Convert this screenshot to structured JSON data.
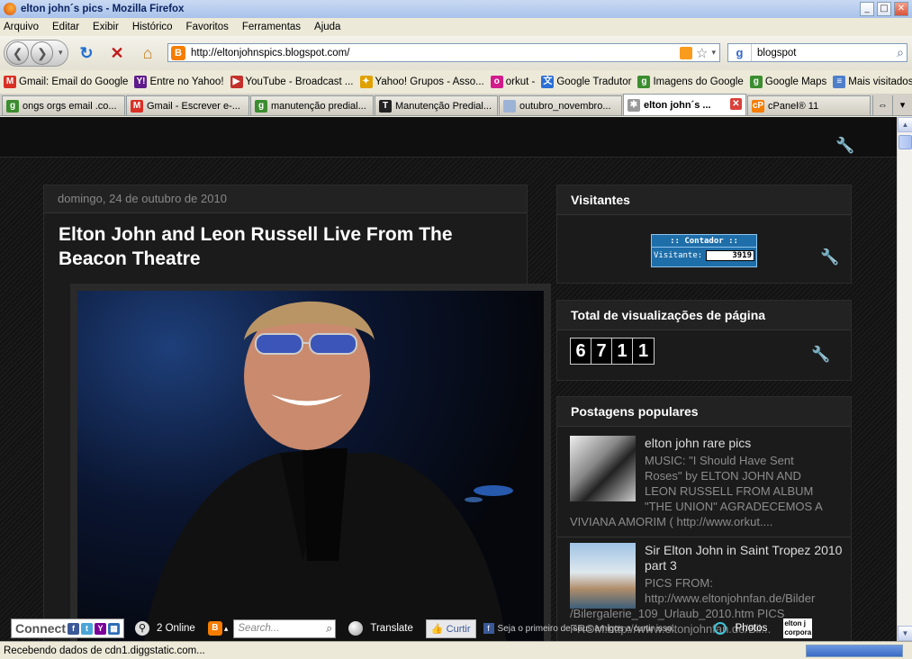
{
  "window": {
    "title": "elton john´s pics - Mozilla Firefox",
    "controls": [
      "_",
      "□",
      "✕"
    ]
  },
  "menu": [
    "Arquivo",
    "Editar",
    "Exibir",
    "Histórico",
    "Favoritos",
    "Ferramentas",
    "Ajuda"
  ],
  "nav": {
    "url": "http://eltonjohnspics.blogspot.com/",
    "search_value": "blogspot",
    "search_engine_icon": "google-icon"
  },
  "bookmarks": [
    {
      "label": "Gmail: Email do Google",
      "icon": "gmail-icon",
      "color": "#d93025",
      "glyph": "M"
    },
    {
      "label": "Entre no Yahoo!",
      "icon": "yahoo-icon",
      "color": "#5f1b8c",
      "glyph": "Y!"
    },
    {
      "label": "YouTube - Broadcast ...",
      "icon": "youtube-icon",
      "color": "#c4302b",
      "glyph": "▶"
    },
    {
      "label": "Yahoo! Grupos - Asso...",
      "icon": "yahoo-groups-icon",
      "color": "#e0a100",
      "glyph": "✦"
    },
    {
      "label": "orkut -",
      "icon": "orkut-icon",
      "color": "#d21c8c",
      "glyph": "o"
    },
    {
      "label": "Google Tradutor",
      "icon": "translate-icon",
      "color": "#2b6fd6",
      "glyph": "文"
    },
    {
      "label": "Imagens do Google",
      "icon": "google-images-icon",
      "color": "#3b8d2f",
      "glyph": "g"
    },
    {
      "label": "Google Maps",
      "icon": "google-maps-icon",
      "color": "#3b8d2f",
      "glyph": "g"
    },
    {
      "label": "Mais visitados",
      "icon": "most-visited-icon",
      "color": "#4f7fc9",
      "glyph": "≡"
    }
  ],
  "tabs": [
    {
      "label": "ongs orgs email .co...",
      "icon": "google-icon",
      "color": "#3b8d2f",
      "glyph": "g"
    },
    {
      "label": "Gmail - Escrever e-...",
      "icon": "gmail-icon",
      "color": "#d93025",
      "glyph": "M"
    },
    {
      "label": "manutenção predial...",
      "icon": "google-icon",
      "color": "#3b8d2f",
      "glyph": "g"
    },
    {
      "label": "Manutenção Predial...",
      "icon": "tab-t-icon",
      "color": "#222222",
      "glyph": "T"
    },
    {
      "label": "outubro_novembro...",
      "icon": "document-icon",
      "color": "#9db3d6",
      "glyph": ""
    },
    {
      "label": "elton john´s ...",
      "icon": "loading-icon",
      "color": "#999999",
      "glyph": "✱",
      "active": true
    },
    {
      "label": "cPanel® 11",
      "icon": "cpanel-icon",
      "color": "#f57d00",
      "glyph": "cP"
    }
  ],
  "post": {
    "date": "domingo, 24 de outubro de 2010",
    "title": "Elton John and Leon Russell Live From The Beacon Theatre"
  },
  "sidebar": {
    "visitors": {
      "title": "Visitantes",
      "counter_label": ":: Contador ::",
      "visitors_label": "Visitante:",
      "count": "3919"
    },
    "pageviews": {
      "title": "Total de visualizações de página",
      "digits": [
        "6",
        "7",
        "1",
        "1"
      ]
    },
    "popular": {
      "title": "Postagens populares",
      "items": [
        {
          "title": "elton john rare pics",
          "snippet_lines": [
            "MUSIC: \"I Should Have Sent",
            "Roses\" by ELTON JOHN AND",
            "LEON RUSSELL FROM ALBUM",
            "\"THE UNION\" AGRADECEMOS A",
            "VIVIANA AMORIM  ( http://www.orkut...."
          ]
        },
        {
          "title": "Sir Elton John in Saint Tropez 2010 part 3",
          "snippet_lines": [
            "PICS FROM:",
            "http://www.eltonjohnfan.de/Bilder",
            "/Bilergalerie_109_Urlaub_2010.htm PICS",
            "FROM:http://www.eltonjohnfan.de/Bil..."
          ]
        }
      ]
    }
  },
  "digg_bar": {
    "connect": "Connect",
    "online": "2 Online",
    "search_placeholder": "Search...",
    "translate": "Translate",
    "like": "Curtir",
    "fb_text": "Seja o primeiro de seus amigos a curtir isso.",
    "photos": "Photos",
    "logo_text": "elton j corpora"
  },
  "status": {
    "text": "Recebendo dados de cdn1.diggstatic.com..."
  }
}
